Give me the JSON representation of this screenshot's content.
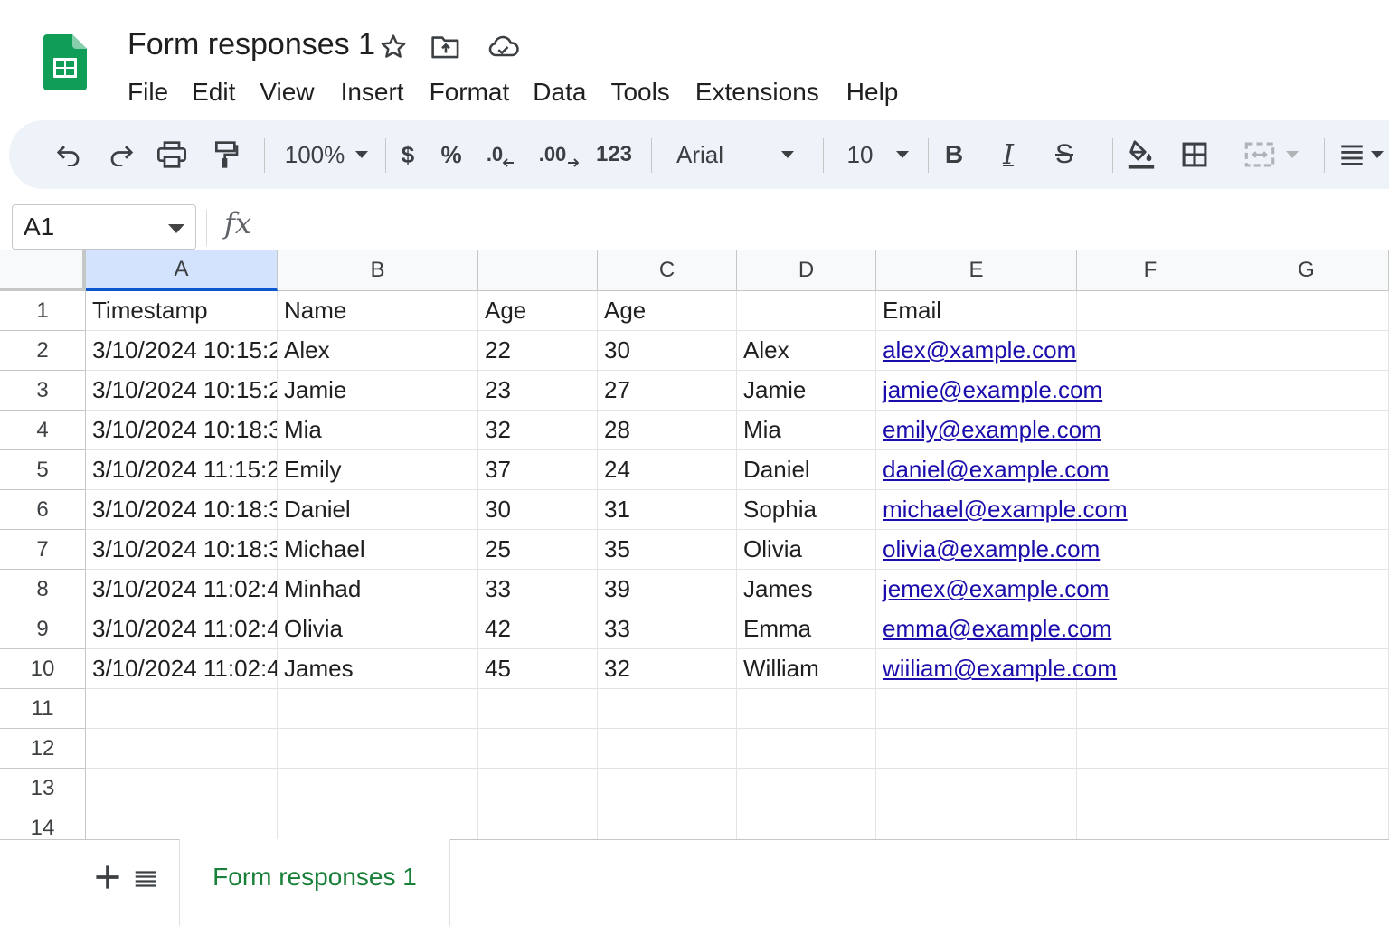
{
  "app": {
    "title": "Form responses 1",
    "menu": [
      "File",
      "Edit",
      "View",
      "Insert",
      "Format",
      "Data",
      "Tools",
      "Extensions",
      "Help"
    ]
  },
  "toolbar": {
    "zoom": "100%",
    "currency": "$",
    "percent": "%",
    "decrease_decimal": ".0",
    "increase_decimal": ".00",
    "more_formats": "123",
    "font": "Arial",
    "font_size": "10",
    "bold": "B",
    "italic": "I",
    "strike": "S"
  },
  "formula_bar": {
    "name_box": "A1",
    "fx": "fx"
  },
  "grid": {
    "columns": [
      "A",
      "B",
      "",
      "C",
      "D",
      "E",
      "F",
      "G"
    ],
    "row_numbers": [
      "1",
      "2",
      "3",
      "4",
      "5",
      "6",
      "7",
      "8",
      "9",
      "10",
      "11",
      "12",
      "13",
      "14"
    ],
    "rows": [
      [
        "Timestamp",
        "Name",
        "Age",
        "Age",
        "",
        "Email"
      ],
      [
        "3/10/2024 10:15:2",
        "Alex",
        "22",
        "30",
        "Alex",
        "alex@xample.com"
      ],
      [
        "3/10/2024 10:15:2",
        "Jamie",
        "23",
        "27",
        "Jamie",
        "jamie@example.com"
      ],
      [
        "3/10/2024 10:18:3",
        "Mia",
        "32",
        "28",
        "Mia",
        "emily@example.com"
      ],
      [
        "3/10/2024 11:15:2",
        "Emily",
        "37",
        "24",
        "Daniel",
        "daniel@example.com"
      ],
      [
        "3/10/2024 10:18:3",
        "Daniel",
        "30",
        "31",
        "Sophia",
        "michael@example.com"
      ],
      [
        "3/10/2024 10:18:3",
        "Michael",
        "25",
        "35",
        "Olivia",
        "olivia@example.com"
      ],
      [
        "3/10/2024 11:02:4",
        "Minhad",
        "33",
        "39",
        "James",
        "jemex@example.com"
      ],
      [
        "3/10/2024 11:02:4",
        "Olivia",
        "42",
        "33",
        "Emma",
        "emma@example.com"
      ],
      [
        "3/10/2024 11:02:4",
        "James",
        "45",
        "32",
        "William",
        "wiiliam@example.com"
      ]
    ]
  },
  "sheets": {
    "tabs": [
      "Form responses 1"
    ]
  },
  "colors": {
    "sheets_green": "#0f9d58",
    "tab_green": "#188038",
    "link_blue": "#1a0dab",
    "toolbar_bg": "#eef2f9",
    "selection_blue": "#d3e3fd"
  }
}
